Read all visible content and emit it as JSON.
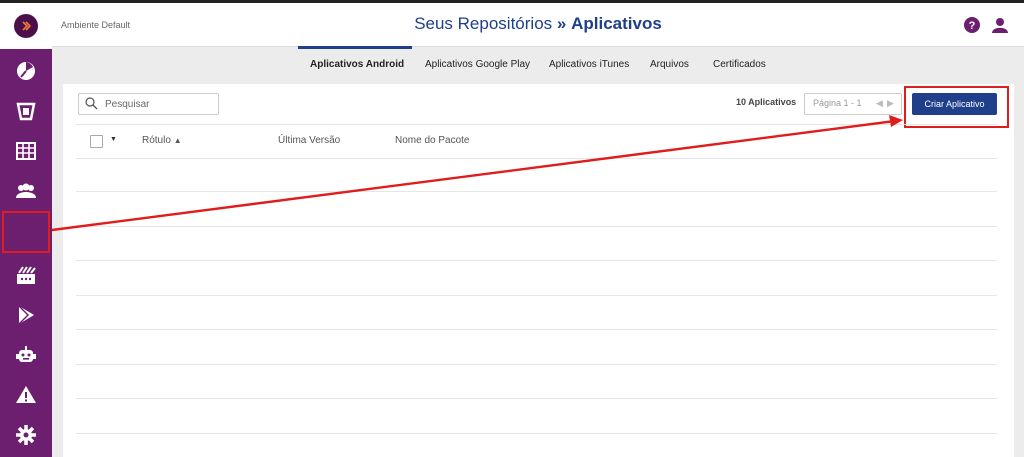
{
  "header": {
    "environment": "Ambiente Default",
    "title_prefix": "Seus Repositórios",
    "title_sep": "»",
    "title_main": "Aplicativos"
  },
  "sidebar": {
    "items": [
      {
        "icon": "pie-chart-icon"
      },
      {
        "icon": "mobile-device-icon"
      },
      {
        "icon": "table-icon"
      },
      {
        "icon": "users-icon"
      },
      {
        "icon": "inbox-download-icon",
        "active": true
      },
      {
        "icon": "app-store-icon"
      },
      {
        "icon": "google-play-icon"
      },
      {
        "icon": "robot-icon"
      },
      {
        "icon": "warning-icon"
      },
      {
        "icon": "gear-icon"
      }
    ]
  },
  "tabs": [
    {
      "label": "Aplicativos Android",
      "active": true
    },
    {
      "label": "Aplicativos Google Play"
    },
    {
      "label": "Aplicativos iTunes"
    },
    {
      "label": "Arquivos"
    },
    {
      "label": "Certificados"
    }
  ],
  "toolbar": {
    "search_placeholder": "Pesquisar",
    "count": "10 Aplicativos",
    "page": "Página 1 - 1",
    "create_button": "Criar Aplicativo"
  },
  "table": {
    "columns": [
      "Rótulo",
      "Última Versão",
      "Nome do Pacote"
    ]
  },
  "colors": {
    "sidebar": "#6b1f6e",
    "accent": "#1f3f8a",
    "highlight": "#e01d1d"
  }
}
